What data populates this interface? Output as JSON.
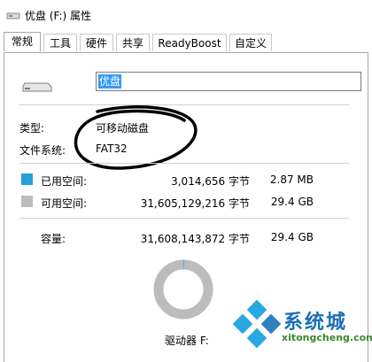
{
  "window": {
    "title": "优盘 (F:) 属性"
  },
  "tabs": [
    "常规",
    "工具",
    "硬件",
    "共享",
    "ReadyBoost",
    "自定义"
  ],
  "general": {
    "name_value": "优盘",
    "type_label": "类型:",
    "type_value": "可移动磁盘",
    "fs_label": "文件系统:",
    "fs_value": "FAT32",
    "used_label": "已用空间:",
    "used_bytes": "3,014,656 字节",
    "used_size": "2.87 MB",
    "free_label": "可用空间:",
    "free_bytes": "31,605,129,216 字节",
    "free_size": "29.4 GB",
    "cap_label": "容量:",
    "cap_bytes": "31,608,143,872 字节",
    "cap_size": "29.4 GB",
    "drive_label": "驱动器 F:",
    "used_fraction": 0.0001,
    "used_color": "#26a0da",
    "free_color": "#bcbcbc"
  },
  "watermark": {
    "brand": "系统城",
    "url": "xitongcheng.com"
  }
}
